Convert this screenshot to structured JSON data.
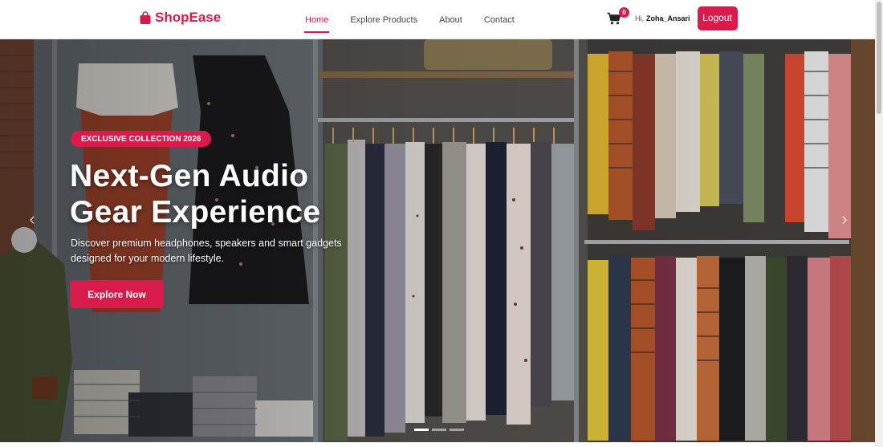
{
  "brand": {
    "name": "ShopEase",
    "icon": "shopping-bag-icon",
    "color": "#d81b4a"
  },
  "nav": {
    "links": [
      {
        "label": "Home",
        "active": true
      },
      {
        "label": "Explore Products",
        "active": false
      },
      {
        "label": "About",
        "active": false
      },
      {
        "label": "Contact",
        "active": false
      }
    ]
  },
  "user": {
    "cart_icon": "cart-icon",
    "cart_count": "0",
    "greeting": "Hi,",
    "username": "Zoha_Ansari",
    "logout_label": "Logout"
  },
  "hero": {
    "badge": "EXCLUSIVE COLLECTION 2026",
    "title_line1": "Next-Gen Audio",
    "title_line2": "Gear Experience",
    "subtitle_line1": "Discover premium headphones, speakers and smart gadgets",
    "subtitle_line2": "designed for your modern lifestyle.",
    "cta_label": "Explore Now",
    "prev_icon": "chevron-left-icon",
    "next_icon": "chevron-right-icon",
    "slides": 3,
    "active_slide": 1
  },
  "colors": {
    "accent": "#d81b4a",
    "text_dark": "#111111",
    "nav_text": "#444444"
  }
}
